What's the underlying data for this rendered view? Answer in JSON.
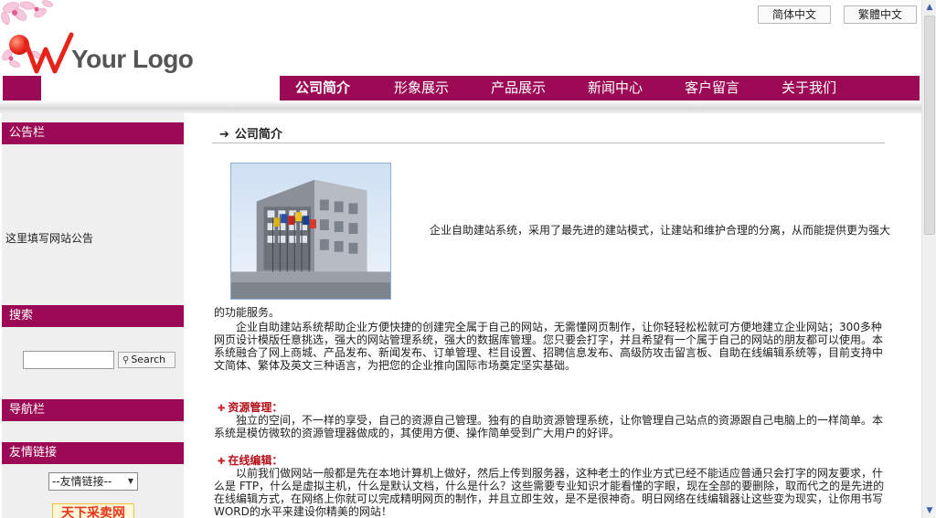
{
  "header": {
    "logo_text": "Your Logo",
    "lang_simplified": "简体中文",
    "lang_traditional": "繁體中文"
  },
  "nav": {
    "items": [
      {
        "label": "公司简介",
        "active": true
      },
      {
        "label": "形象展示",
        "active": false
      },
      {
        "label": "产品展示",
        "active": false
      },
      {
        "label": "新闻中心",
        "active": false
      },
      {
        "label": "客户留言",
        "active": false
      },
      {
        "label": "关于我们",
        "active": false
      }
    ]
  },
  "sidebar": {
    "notice_title": "公告栏",
    "notice_text": "这里填写网站公告",
    "search_title": "搜索",
    "search_value": "",
    "search_button": "Search",
    "nav_title": "导航栏",
    "friends_title": "友情链接",
    "friends_select": "--友情链接--",
    "partner_logo_text": "天下采卖网"
  },
  "main": {
    "section_title": "公司简介",
    "intro_first_line": "企业自助建站系统，采用了最先进的建站模式，让建站和维护合理的分离，从而能提供更为强大",
    "intro_second_line": "的功能服务。",
    "intro_paragraph": "企业自助建站系统帮助企业方便快捷的创建完全属于自己的网站，无需懂网页制作，让你轻轻松松就可方便地建立企业网站；300多种网页设计模版任意挑选，强大的网站管理系统，强大的数据库管理。您只要会打字，并且希望有一个属于自己的网站的朋友都可以使用。本系统融合了网上商城、产品发布、新闻发布、订单管理、栏目设置、招聘信息发布、高级防攻击留言板、自助在线编辑系统等，目前支持中文简体、繁体及英文三种语言，为把您的企业推向国际市场奠定坚实基础。",
    "feature1_title": "资源管理：",
    "feature1_text": "独立的空间，不一样的享受，自己的资源自己管理。独有的自助资源管理系统，让你管理自己站点的资源跟自己电脑上的一样简单。本系统是模仿微软的资源管理器做成的，其使用方便、操作简单受到广大用户的好评。",
    "feature2_title": "在线编辑：",
    "feature2_text": "以前我们做网站一般都是先在本地计算机上做好，然后上传到服务器，这种老土的作业方式已经不能适应普通只会打字的网友要求，什么是 FTP，什么是虚拟主机，什么是默认文档，什么是什么？这些需要专业知识才能看懂的字眼，现在全部的要删除，取而代之的是先进的在线编辑方式，在网络上你就可以完成精明网页的制作，并且立即生效，是不是很神奇。明日网络在线编辑器让这些变为现实，让你用书写WORD的水平来建设你精美的网站！"
  },
  "colors": {
    "accent": "#9c0a55",
    "sidebar_bg": "#efefef",
    "feature_title": "#b5101a"
  },
  "icons": [
    "flower-decoration-icon",
    "logo-ball-icon",
    "right-arrow-icon",
    "magnifier-icon",
    "dropdown-arrow-icon",
    "red-bullet-icon",
    "scroll-up-icon",
    "scroll-down-icon"
  ]
}
